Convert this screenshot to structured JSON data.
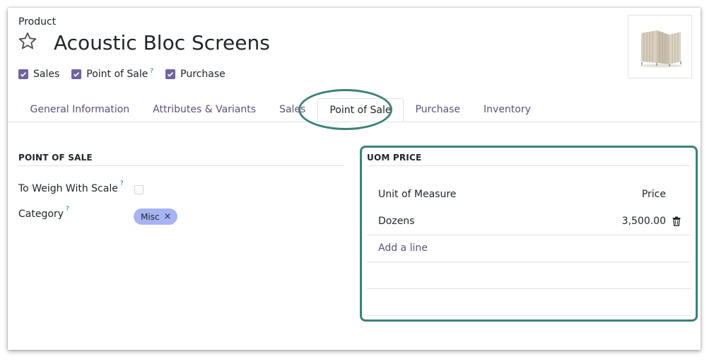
{
  "header": {
    "breadcrumb": "Product",
    "title": "Acoustic Bloc Screens",
    "favorite_icon": "star-icon"
  },
  "flags": [
    {
      "label": "Sales",
      "checked": true,
      "help": false
    },
    {
      "label": "Point of Sale",
      "checked": true,
      "help": true
    },
    {
      "label": "Purchase",
      "checked": true,
      "help": false
    }
  ],
  "help_mark": "?",
  "tabs": [
    {
      "label": "General Information",
      "active": false
    },
    {
      "label": "Attributes & Variants",
      "active": false
    },
    {
      "label": "Sales",
      "active": false
    },
    {
      "label": "Point of Sale",
      "active": true
    },
    {
      "label": "Purchase",
      "active": false
    },
    {
      "label": "Inventory",
      "active": false
    }
  ],
  "pos_section": {
    "title": "POINT OF SALE",
    "weigh_label": "To Weigh With Scale",
    "weigh_checked": false,
    "category_label": "Category",
    "category_tag": "Misc",
    "tag_remove": "×"
  },
  "uom_section": {
    "title": "UOM PRICE",
    "columns": {
      "uom": "Unit of Measure",
      "price": "Price"
    },
    "rows": [
      {
        "uom": "Dozens",
        "price": "3,500.00"
      }
    ],
    "add_line": "Add a line"
  },
  "colors": {
    "accent": "#71639e",
    "link": "#5c5276",
    "highlight": "#3d8178",
    "tag": "#a7b4f4",
    "help": "#017e84"
  }
}
